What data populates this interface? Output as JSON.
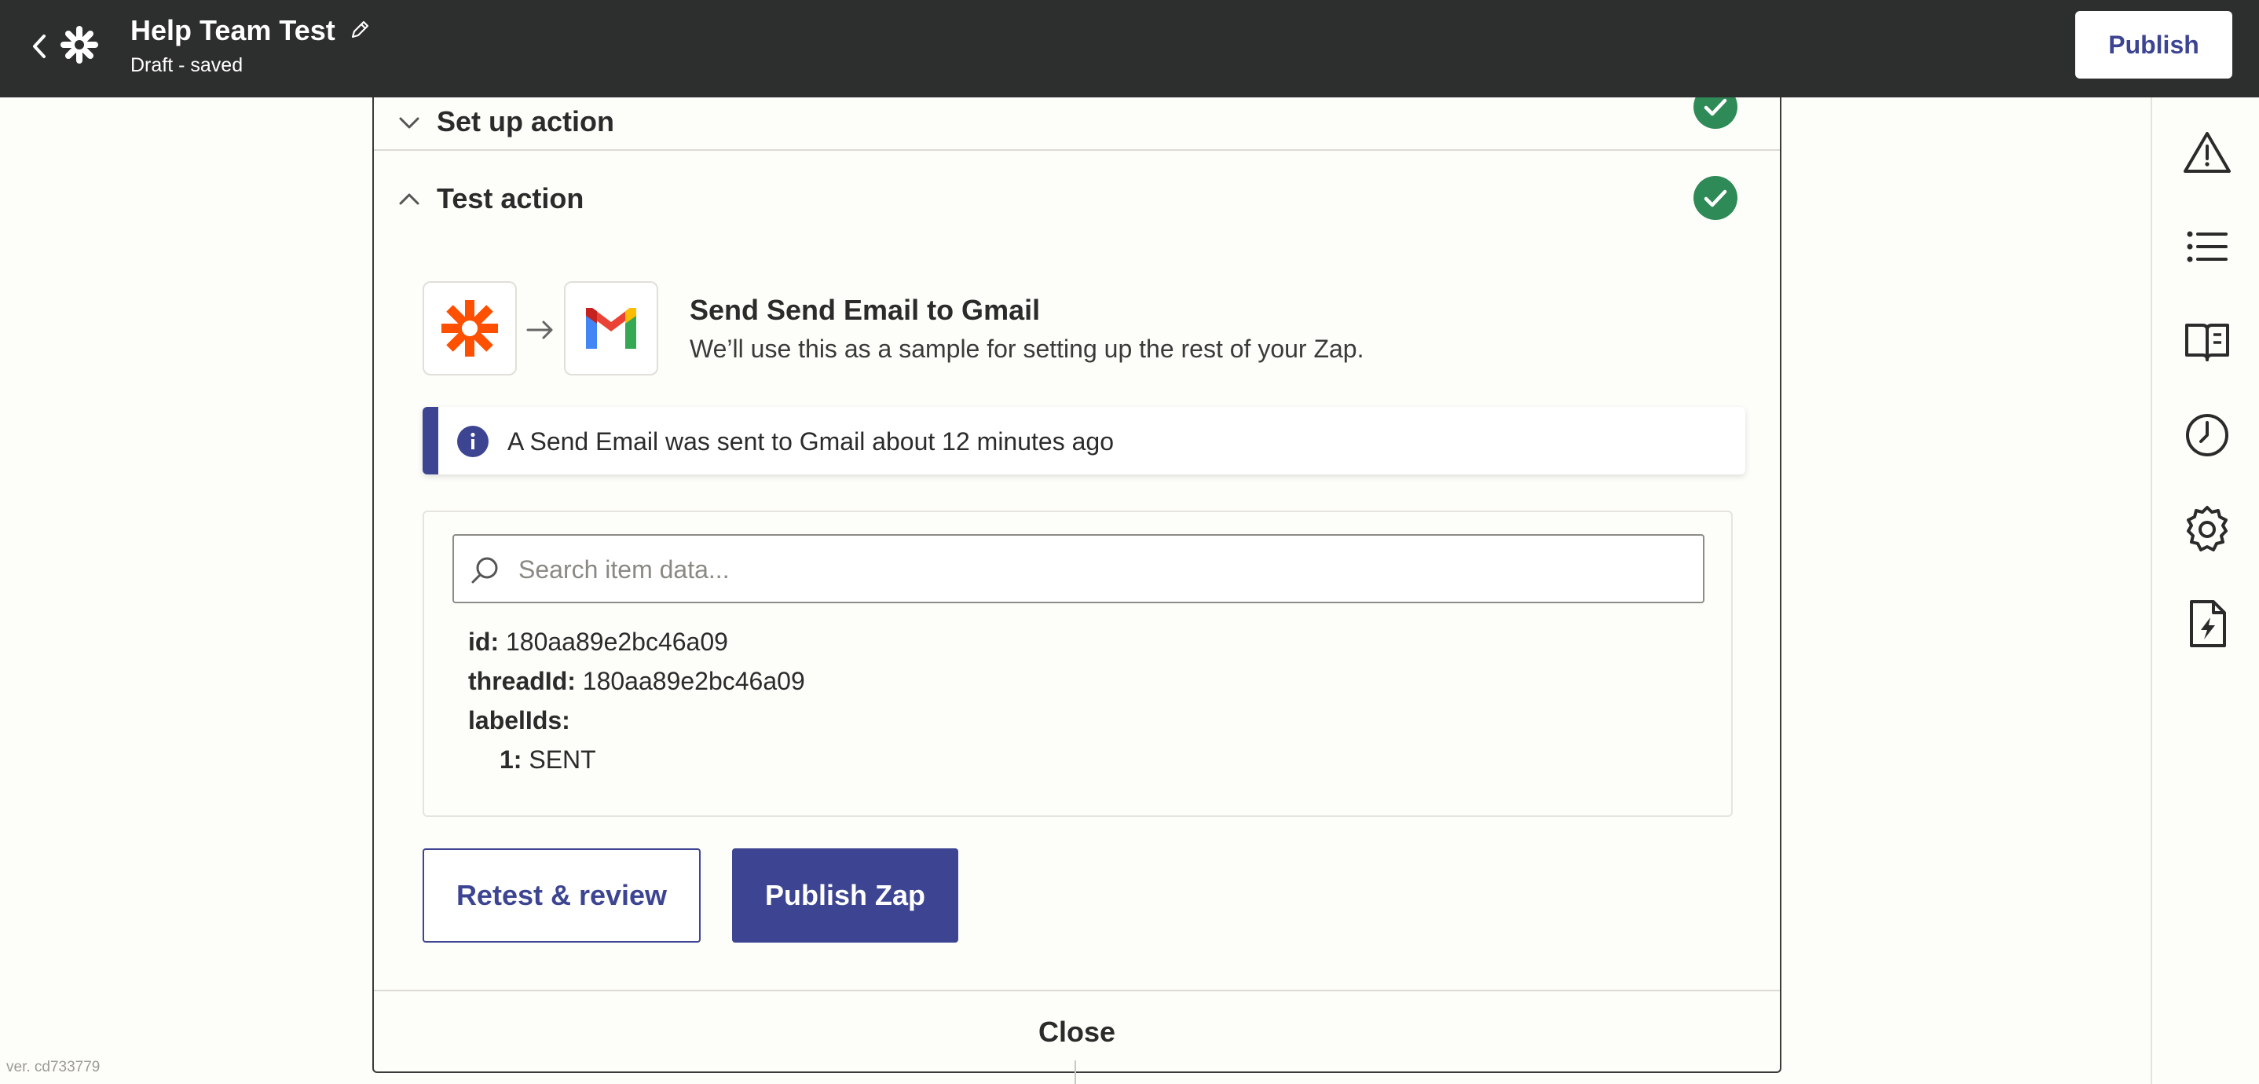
{
  "topbar": {
    "title": "Help Team Test",
    "status": "Draft - saved",
    "publish_label": "Publish"
  },
  "sections": {
    "setup_title": "Set up action",
    "test_title": "Test action"
  },
  "step": {
    "title": "Send Send Email to Gmail",
    "subtitle": "We’ll use this as a sample for setting up the rest of your Zap.",
    "source_icon": "zapier-icon",
    "target_icon": "gmail-icon"
  },
  "info": {
    "text": "A Send Email was sent to Gmail about 12 minutes ago"
  },
  "search": {
    "placeholder": "Search item data...",
    "value": ""
  },
  "data": {
    "rows": [
      {
        "key": "id:",
        "value": "180aa89e2bc46a09"
      },
      {
        "key": "threadId:",
        "value": "180aa89e2bc46a09"
      },
      {
        "key": "labelIds:",
        "value": ""
      },
      {
        "key": "1:",
        "value": "SENT"
      }
    ]
  },
  "buttons": {
    "retest": "Retest & review",
    "publish_zap": "Publish Zap",
    "close": "Close"
  },
  "rail": {
    "icons": [
      "warning-icon",
      "list-icon",
      "book-icon",
      "clock-icon",
      "gear-icon",
      "file-bolt-icon"
    ]
  },
  "version": "ver. cd733779",
  "colors": {
    "brand": "#3d4592",
    "topbar": "#2d2e2e",
    "success": "#2e8b57",
    "zapier_orange": "#ff4f00"
  }
}
